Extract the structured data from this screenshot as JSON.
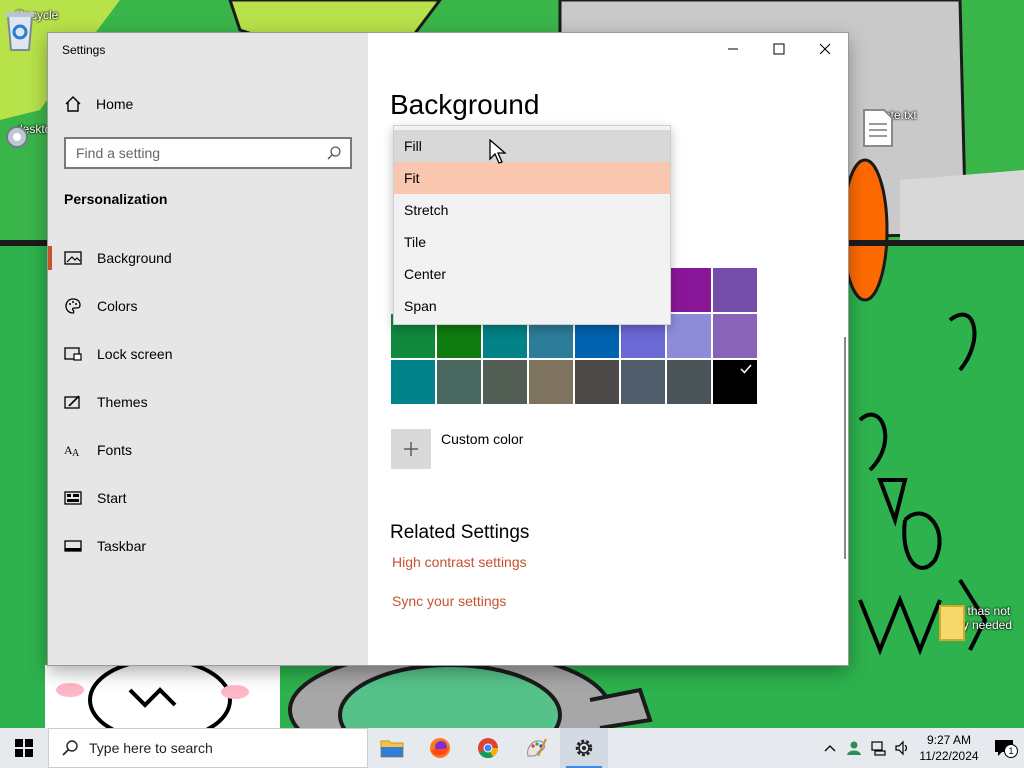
{
  "desktop": {
    "icons": [
      {
        "name": "recycle-bin",
        "label": "Recycle"
      },
      {
        "name": "desktop-settings",
        "label": "desktop"
      },
      {
        "name": "note-file",
        "label": "note.txt"
      },
      {
        "name": "folder",
        "label": "stuff thas not really needed"
      }
    ]
  },
  "window": {
    "title": "Settings",
    "minimize_glyph": "—",
    "maximize_glyph": "☐",
    "close_glyph": "✕"
  },
  "sidebar": {
    "home_label": "Home",
    "search_placeholder": "Find a setting",
    "section_title": "Personalization",
    "items": [
      {
        "label": "Background",
        "icon": "image-icon",
        "selected": true
      },
      {
        "label": "Colors",
        "icon": "palette-icon",
        "selected": false
      },
      {
        "label": "Lock screen",
        "icon": "lock-screen-icon",
        "selected": false
      },
      {
        "label": "Themes",
        "icon": "themes-icon",
        "selected": false
      },
      {
        "label": "Fonts",
        "icon": "fonts-icon",
        "selected": false
      },
      {
        "label": "Start",
        "icon": "start-icon",
        "selected": false
      },
      {
        "label": "Taskbar",
        "icon": "taskbar-icon",
        "selected": false
      }
    ]
  },
  "content": {
    "title": "Background",
    "custom_color_label": "Custom color",
    "related_title": "Related Settings",
    "links": [
      "High contrast settings",
      "Sync your settings"
    ],
    "swatches": {
      "row0": [
        "#881798",
        "#744da9"
      ],
      "row1": [
        "#10893e",
        "#107c10",
        "#038387",
        "#2d7d9a",
        "#0063b1",
        "#6b69d6",
        "#8e8cd8",
        "#8764b8"
      ],
      "row2": [
        "#00838a",
        "#486860",
        "#525e54",
        "#7e735f",
        "#4c4a48",
        "#515c6b",
        "#4a5459",
        "#000000"
      ],
      "selected_swatch": "#000000"
    }
  },
  "dropdown": {
    "items": [
      "Fill",
      "Fit",
      "Stretch",
      "Tile",
      "Center",
      "Span"
    ],
    "hover_index": 0,
    "selected_index": 1
  },
  "taskbar": {
    "search_placeholder": "Type here to search",
    "time": "9:27 AM",
    "date": "11/22/2024",
    "notification_count": "1"
  },
  "colors": {
    "accent": "#c8512f",
    "selected_item_bg": "#f9c6b0",
    "sidebar_bg": "#e6e6e6"
  }
}
